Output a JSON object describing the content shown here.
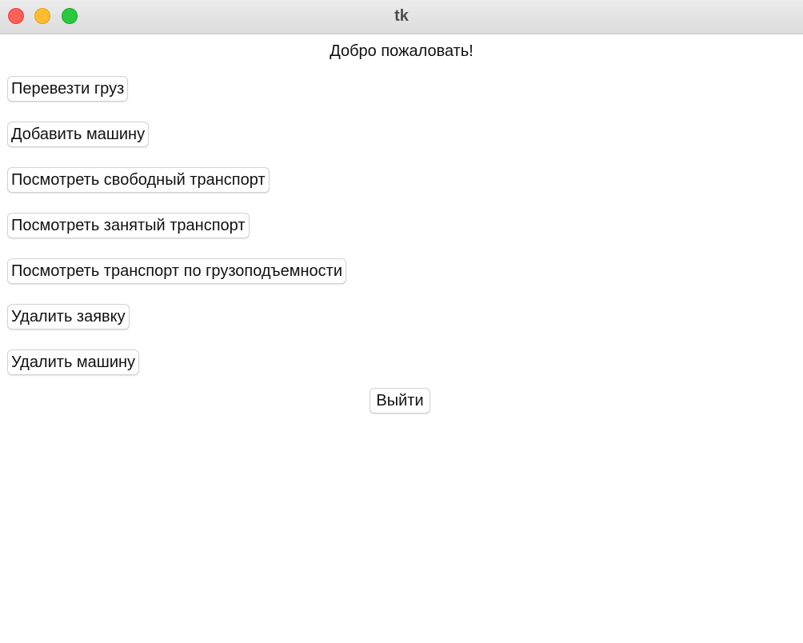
{
  "window": {
    "title": "tk",
    "controls": {
      "close_color": "#fe5f57",
      "minimize_color": "#febc2e",
      "zoom_color": "#28c840"
    }
  },
  "main": {
    "welcome": "Добро пожаловать!",
    "buttons": [
      {
        "label": "Перевезти груз"
      },
      {
        "label": "Добавить машину"
      },
      {
        "label": "Посмотреть свободный транспорт"
      },
      {
        "label": "Посмотреть занятый транспорт"
      },
      {
        "label": "Посмотреть транспорт по грузоподъемности"
      },
      {
        "label": "Удалить заявку"
      },
      {
        "label": "Удалить машину"
      }
    ],
    "exit_label": "Выйти"
  }
}
